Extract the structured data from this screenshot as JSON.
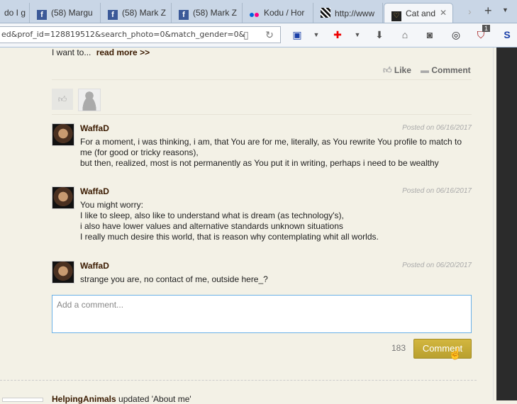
{
  "browser": {
    "tabs": [
      {
        "label": "do I g",
        "icon": "page-icon"
      },
      {
        "label": "(58) Margu",
        "icon": "facebook-icon"
      },
      {
        "label": "(58) Mark Z",
        "icon": "facebook-icon"
      },
      {
        "label": "(58) Mark Z",
        "icon": "facebook-icon"
      },
      {
        "label": "Kodu / Hor",
        "icon": "flickr-icon"
      },
      {
        "label": "http://www",
        "icon": "site-icon"
      },
      {
        "label": "Cat and",
        "icon": "heart-logo-icon",
        "active": true
      }
    ],
    "url": "ed&prof_id=128819512&search_photo=0&match_gender=0&",
    "badge_count": "1"
  },
  "post": {
    "excerpt": "I want to...",
    "read_more": "read more >>",
    "like_label": "Like",
    "comment_label": "Comment"
  },
  "comments": [
    {
      "author": "WaffaD",
      "date": "Posted on 06/16/2017",
      "lines": [
        "For a moment, i was thinking, i am, that You are for me, literally, as You rewrite You profile to match to",
        "me (for good or tricky reasons),",
        "but then, realized, most is not permanently as You put it in writing, perhaps i need to be wealthy"
      ]
    },
    {
      "author": "WaffaD",
      "date": "Posted on 06/16/2017",
      "lines": [
        "You might worry:",
        "I like to sleep, also like to understand what is dream (as technology's),",
        "i also have lower values and alternative standards unknown situations",
        "I really much desire this world, that is reason why contemplating whit all worlds."
      ]
    },
    {
      "author": "WaffaD",
      "date": "Posted on 06/20/2017",
      "lines": [
        "strange you are, no contact of me, outside here_?"
      ]
    }
  ],
  "composer": {
    "placeholder": "Add a comment...",
    "char_count": "183",
    "submit_label": "Comment"
  },
  "next_activity": {
    "author": "HelpingAnimals",
    "action": "updated 'About me'"
  }
}
